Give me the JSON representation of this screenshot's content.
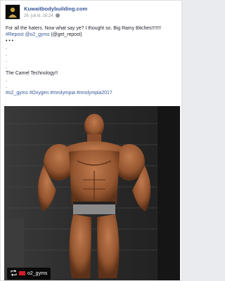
{
  "post": {
    "page_name": "Kuwaitbodybuilding.com",
    "timestamp": "26. juli kl. 16:24",
    "privacy_icon": "globe-icon",
    "text_line_1": "For all the haters. Now what say ye? I thought so. Big Ramy Bitches!!!!!!!",
    "repost_hashtag": "#Repost",
    "repost_mention": "@o2_gyms",
    "repost_rest": "(@get_repost)",
    "dots_a": "• • •",
    "dot": ".",
    "line_tech": "The Camel Technology!!",
    "hashtags": [
      "#o2_gyms",
      "#Oxygen",
      "#mrolympia",
      "#mrolympia2017"
    ]
  },
  "image": {
    "repost_label": "o2_gyms",
    "repost_icon": "repost-icon",
    "colors": {
      "bg": "#2a2a2a",
      "skin": "#a0623f",
      "shorts": "#8a8a8a"
    }
  },
  "colors": {
    "link": "#365899",
    "text": "#1d2129",
    "meta": "#90949c"
  }
}
